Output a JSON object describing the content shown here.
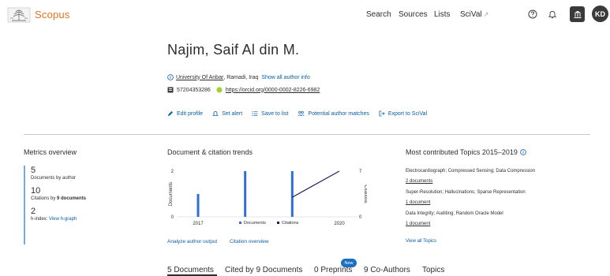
{
  "header": {
    "brand": "Scopus",
    "nav": {
      "search": "Search",
      "sources": "Sources",
      "lists": "Lists",
      "scival": "SciVal",
      "scival_ext": "↗"
    },
    "avatar_initials": "KD"
  },
  "profile": {
    "name": "Najim, Saif Al din M.",
    "affiliation": "University Of Anbar",
    "location": ", Ramadi, Iraq",
    "show_all": "Show all author info",
    "author_id": "57204353286",
    "orcid": "https://orcid.org/0000-0002-8226-6982",
    "actions": {
      "edit": "Edit profile",
      "alert": "Set alert",
      "save": "Save to list",
      "potential": "Potential author matches",
      "export": "Export to SciVal"
    }
  },
  "metrics": {
    "title": "Metrics overview",
    "documents": {
      "value": "5",
      "label": "Documents by author"
    },
    "citations": {
      "value": "10",
      "label_prefix": "Citations by ",
      "label_bold": "9 documents"
    },
    "hindex": {
      "value": "2",
      "label": "h-index:",
      "link": "View h-graph"
    }
  },
  "trends": {
    "title": "Document & citation trends",
    "analyze": "Analyze author output",
    "overview": "Citation overview"
  },
  "chart_data": {
    "type": "bar",
    "x": [
      2017,
      2018,
      2019,
      2020
    ],
    "xticks": [
      "2017",
      "2020"
    ],
    "y_left_label": "Documents",
    "y_right_label": "Citations",
    "y_left_ticks": [
      "2",
      "0"
    ],
    "y_right_ticks": [
      "7",
      "0"
    ],
    "ylim_left": [
      0,
      2
    ],
    "ylim_right": [
      0,
      7
    ],
    "series": [
      {
        "name": "Documents",
        "type": "bar",
        "values": [
          1,
          2,
          2,
          0
        ]
      },
      {
        "name": "Citations",
        "type": "line",
        "values": [
          null,
          null,
          3,
          7
        ]
      }
    ],
    "colors": {
      "documents": "#2f6fd6",
      "citations": "#1b1f5e"
    }
  },
  "topics": {
    "title": "Most contributed Topics 2015–2019",
    "items": [
      {
        "name": "Electrocardiograph; Compressed Sensing; Data Compression",
        "docs": "2 documents"
      },
      {
        "name": "Super-Resolution; Hallucinations; Sparse Representation",
        "docs": "1 document"
      },
      {
        "name": "Data Integrity; Auditing; Random Oracle Model",
        "docs": "1 document"
      }
    ],
    "view_all": "View all Topics"
  },
  "tabs": {
    "documents": "5 Documents",
    "cited_by": "Cited by 9 Documents",
    "preprints": "0 Preprints",
    "coauthors": "9 Co-Authors",
    "topics": "Topics",
    "new_badge": "New"
  }
}
